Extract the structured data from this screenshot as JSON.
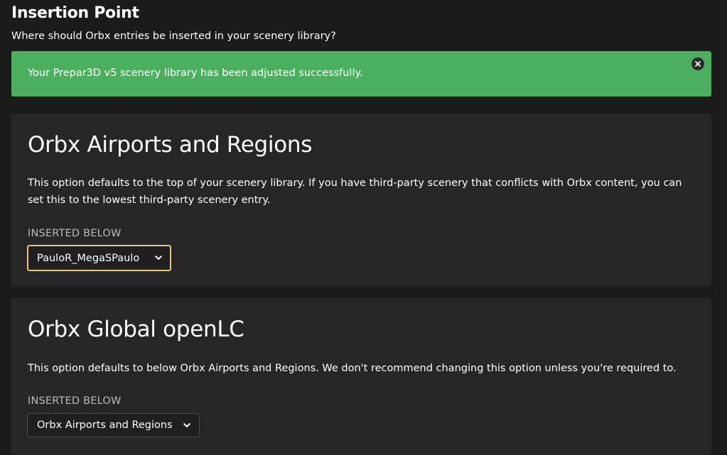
{
  "header": {
    "title": "Insertion Point",
    "subtitle": "Where should Orbx entries be inserted in your scenery library?"
  },
  "alert": {
    "message": "Your Prepar3D v5 scenery library has been adjusted successfully.",
    "close_icon": "close-icon",
    "color": "#4caf5f"
  },
  "sections": [
    {
      "title": "Orbx Airports and Regions",
      "description": "This option defaults to the top of your scenery library. If you have third-party scenery that conflicts with Orbx content, you can set this to the lowest third-party scenery entry.",
      "field_label": "INSERTED BELOW",
      "selected_value": "PauloR_MegaSPaulo",
      "chevron_icon": "chevron-down-icon"
    },
    {
      "title": "Orbx Global openLC",
      "description": "This option defaults to below Orbx Airports and Regions. We don't recommend changing this option unless you're required to.",
      "field_label": "INSERTED BELOW",
      "selected_value": "Orbx Airports and Regions",
      "chevron_icon": "chevron-down-icon"
    }
  ],
  "colors": {
    "background": "#1b1b1b",
    "card": "#262626",
    "success": "#4caf5f",
    "focus_border": "#e8c97a"
  }
}
